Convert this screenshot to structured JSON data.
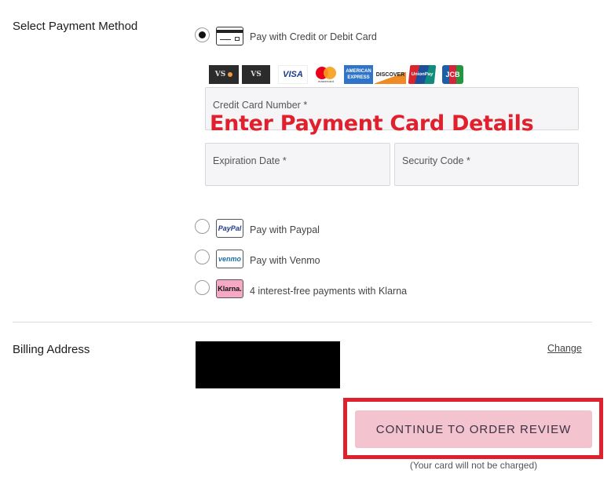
{
  "payment": {
    "section_title": "Select Payment Method",
    "methods": [
      {
        "label": "Pay with Credit or Debit Card",
        "icon": "credit-card-icon",
        "selected": true
      },
      {
        "label": "Pay with Paypal",
        "icon": "paypal-icon",
        "icon_text": "PayPal",
        "selected": false
      },
      {
        "label": "Pay with Venmo",
        "icon": "venmo-icon",
        "icon_text": "venmo",
        "selected": false
      },
      {
        "label": "4 interest-free payments with Klarna",
        "icon": "klarna-icon",
        "icon_text": "Klarna.",
        "selected": false
      }
    ],
    "card_logos": [
      {
        "name": "vs-mastercard-logo",
        "text": "VS"
      },
      {
        "name": "vs-card-logo",
        "text": "VS"
      },
      {
        "name": "visa-logo",
        "text": "VISA"
      },
      {
        "name": "mastercard-logo",
        "text": "mastercard"
      },
      {
        "name": "amex-logo",
        "text": "AMERICAN EXPRESS"
      },
      {
        "name": "discover-logo",
        "text": "DISCOVER"
      },
      {
        "name": "unionpay-logo",
        "text": "UnionPay"
      },
      {
        "name": "jcb-logo",
        "text": "JCB"
      }
    ],
    "fields": {
      "card_number": {
        "label": "Credit Card Number *",
        "value": ""
      },
      "expiration": {
        "label": "Expiration Date *",
        "value": ""
      },
      "security_code": {
        "label": "Security Code *",
        "value": ""
      }
    },
    "annotation": "Enter Payment Card Details"
  },
  "billing": {
    "section_title": "Billing Address",
    "change_label": "Change"
  },
  "cta": {
    "label": "CONTINUE TO ORDER REVIEW",
    "note": "(Your card will not be charged)"
  },
  "colors": {
    "cta_bg": "#f3c4cf",
    "highlight": "#e0202c",
    "field_bg": "#f5f5f7"
  }
}
